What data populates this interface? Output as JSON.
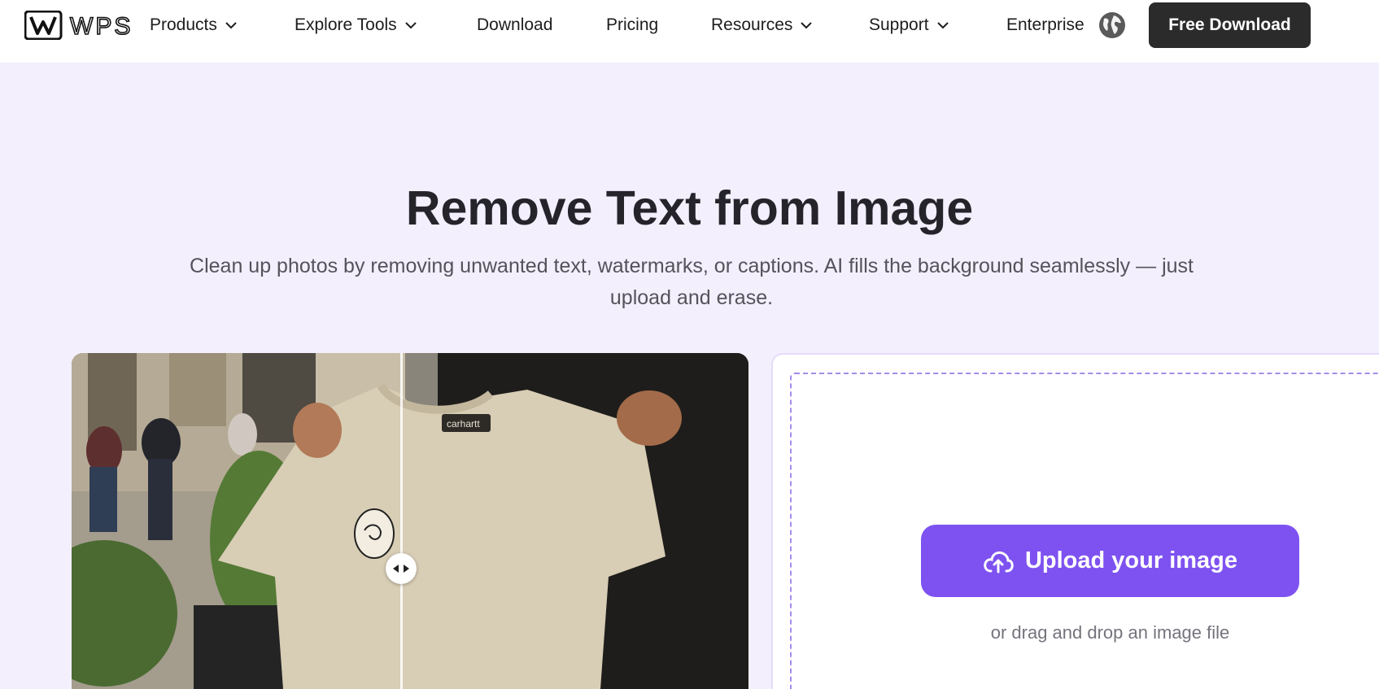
{
  "nav": {
    "logo_text": "WPS",
    "items": [
      {
        "label": "Products",
        "dropdown": true
      },
      {
        "label": "Explore Tools",
        "dropdown": true
      },
      {
        "label": "Download",
        "dropdown": false
      },
      {
        "label": "Pricing",
        "dropdown": false
      },
      {
        "label": "Resources",
        "dropdown": true
      },
      {
        "label": "Support",
        "dropdown": true
      },
      {
        "label": "Enterprise",
        "dropdown": false
      }
    ],
    "language_icon": "globe-icon",
    "cta_label": "Free Download"
  },
  "hero": {
    "title": "Remove Text from Image",
    "subtitle": "Clean up photos by removing unwanted text, watermarks, or captions. AI fills the background seamlessly — just upload and erase."
  },
  "preview": {
    "image_description_icon": "before-after-compare",
    "shirt_brand": "carhartt",
    "slider_icon": "compare-arrows-icon"
  },
  "upload": {
    "button_label": "Upload your image",
    "button_icon": "cloud-upload-icon",
    "hint": "or drag and drop an image file"
  },
  "colors": {
    "accent": "#7e52f0",
    "page_bg": "#f3effd",
    "cta_bg": "#2b2b2b"
  }
}
